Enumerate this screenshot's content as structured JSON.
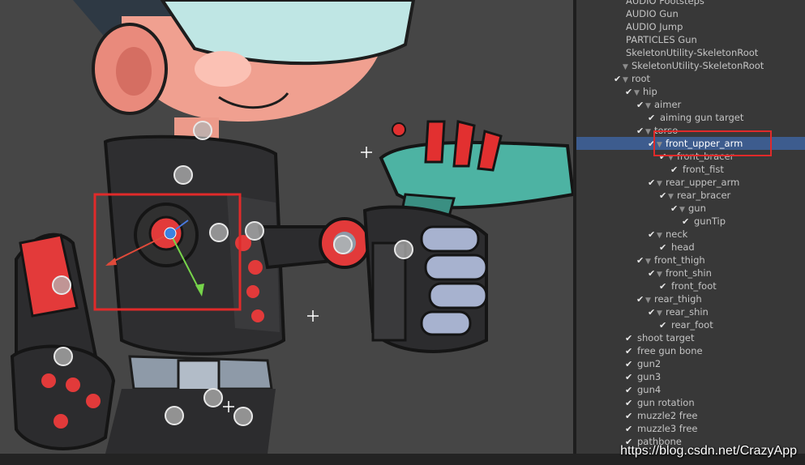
{
  "hierarchy": {
    "rows": [
      {
        "label": "AUDIO Footsteps",
        "check": false,
        "arrow": false,
        "depth": 0
      },
      {
        "label": "AUDIO Gun",
        "check": false,
        "arrow": false,
        "depth": 0
      },
      {
        "label": "AUDIO Jump",
        "check": false,
        "arrow": false,
        "depth": 0
      },
      {
        "label": "PARTICLES Gun",
        "check": false,
        "arrow": false,
        "depth": 0
      },
      {
        "label": "SkeletonUtility-SkeletonRoot",
        "check": false,
        "arrow": false,
        "depth": 0
      },
      {
        "label": "SkeletonUtility-SkeletonRoot",
        "check": false,
        "arrow": true,
        "depth": 0
      },
      {
        "label": "root",
        "check": true,
        "arrow": true,
        "depth": 0
      },
      {
        "label": "hip",
        "check": true,
        "arrow": true,
        "depth": 1
      },
      {
        "label": "aimer",
        "check": true,
        "arrow": true,
        "depth": 2
      },
      {
        "label": "aiming gun target",
        "check": true,
        "arrow": false,
        "depth": 3
      },
      {
        "label": "torso",
        "check": true,
        "arrow": true,
        "depth": 2
      },
      {
        "label": "front_upper_arm",
        "check": true,
        "arrow": true,
        "depth": 3,
        "selected": true
      },
      {
        "label": "front_bracer",
        "check": true,
        "arrow": true,
        "depth": 4
      },
      {
        "label": "front_fist",
        "check": true,
        "arrow": false,
        "depth": 5
      },
      {
        "label": "rear_upper_arm",
        "check": true,
        "arrow": true,
        "depth": 3
      },
      {
        "label": "rear_bracer",
        "check": true,
        "arrow": true,
        "depth": 4
      },
      {
        "label": "gun",
        "check": true,
        "arrow": true,
        "depth": 5
      },
      {
        "label": "gunTip",
        "check": true,
        "arrow": false,
        "depth": 6
      },
      {
        "label": "neck",
        "check": true,
        "arrow": true,
        "depth": 3
      },
      {
        "label": "head",
        "check": true,
        "arrow": false,
        "depth": 4
      },
      {
        "label": "front_thigh",
        "check": true,
        "arrow": true,
        "depth": 2
      },
      {
        "label": "front_shin",
        "check": true,
        "arrow": true,
        "depth": 3
      },
      {
        "label": "front_foot",
        "check": true,
        "arrow": false,
        "depth": 4
      },
      {
        "label": "rear_thigh",
        "check": true,
        "arrow": true,
        "depth": 2
      },
      {
        "label": "rear_shin",
        "check": true,
        "arrow": true,
        "depth": 3
      },
      {
        "label": "rear_foot",
        "check": true,
        "arrow": false,
        "depth": 4
      },
      {
        "label": "shoot target",
        "check": true,
        "arrow": false,
        "depth": 1
      },
      {
        "label": "free gun bone",
        "check": true,
        "arrow": false,
        "depth": 1
      },
      {
        "label": "gun2",
        "check": true,
        "arrow": false,
        "depth": 1
      },
      {
        "label": "gun3",
        "check": true,
        "arrow": false,
        "depth": 1
      },
      {
        "label": "gun4",
        "check": true,
        "arrow": false,
        "depth": 1
      },
      {
        "label": "gun rotation",
        "check": true,
        "arrow": false,
        "depth": 1
      },
      {
        "label": "muzzle2 free",
        "check": true,
        "arrow": false,
        "depth": 1
      },
      {
        "label": "muzzle3 free",
        "check": true,
        "arrow": false,
        "depth": 1
      },
      {
        "label": "pathbone",
        "check": true,
        "arrow": false,
        "depth": 1
      }
    ]
  },
  "icons": {
    "check": "✔",
    "arrow": "▼"
  },
  "watermark": "https://blog.csdn.net/CrazyApp",
  "colors": {
    "selection": "#3d5c8e",
    "highlight_box": "#e02a2a",
    "scene_bg": "#464646",
    "panel_bg": "#383838"
  }
}
